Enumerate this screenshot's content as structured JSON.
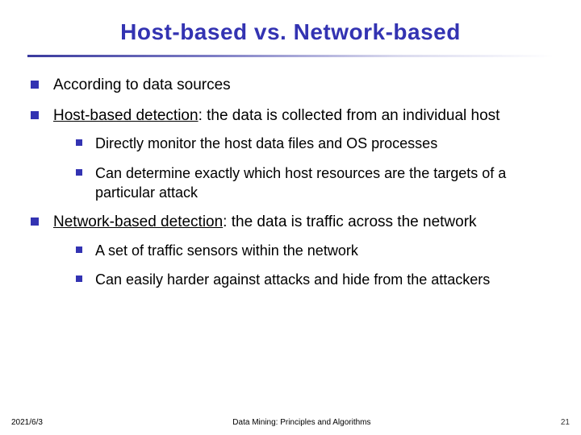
{
  "title": "Host-based vs. Network-based",
  "bullets": {
    "b1": "According to data sources",
    "b2_lead": "Host-based detection",
    "b2_rest": ": the data is collected from an individual host",
    "b2_sub1": "Directly monitor the host data files and OS processes",
    "b2_sub2": "Can determine exactly which host resources are the targets of a particular attack",
    "b3_lead": "Network-based detection",
    "b3_rest": ": the data is traffic across the network",
    "b3_sub1": "A set of traffic sensors within the network",
    "b3_sub2": "Can easily harder against attacks and hide from the attackers"
  },
  "footer": {
    "date": "2021/6/3",
    "source": "Data Mining: Principles and Algorithms",
    "page": "21"
  }
}
